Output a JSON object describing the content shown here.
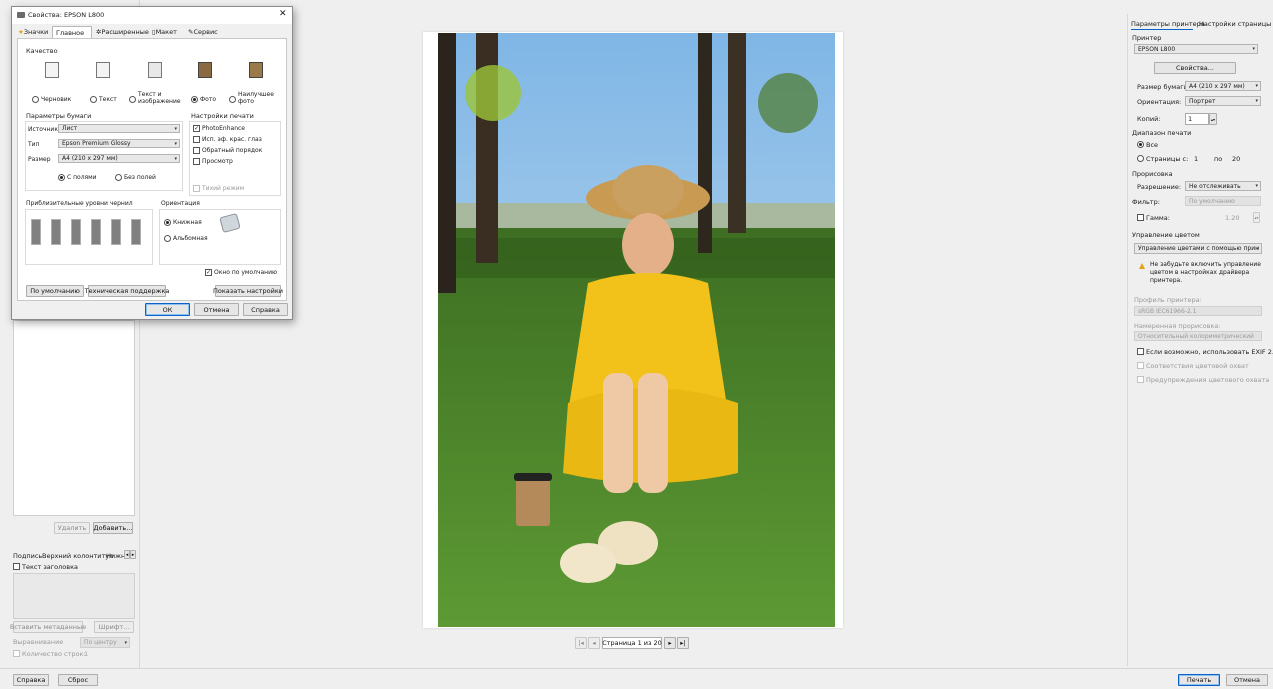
{
  "dialog": {
    "title": "Свойства: EPSON L800",
    "tabs": [
      "Значки",
      "Главное",
      "Расширенные",
      "Макет",
      "Сервис"
    ],
    "quality_label": "Качество",
    "quality_options": [
      "Черновик",
      "Текст",
      "Текст и изображение",
      "Фото",
      "Наилучшее фото"
    ],
    "paper_params_label": "Параметры бумаги",
    "source_label": "Источник",
    "source_value": "Лист",
    "type_label": "Тип",
    "type_value": "Epson Premium Glossy",
    "size_label": "Размер",
    "size_value": "A4 (210 x 297 мм)",
    "border_on": "С полями",
    "border_off": "Без полей",
    "print_settings_label": "Настройки печати",
    "print_settings": [
      "PhotoEnhance",
      "Исп. эф. крас. глаз",
      "Обратный порядок",
      "Просмотр"
    ],
    "quiet_mode": "Тихий режим",
    "ink_levels_label": "Приблизительные уровни чернил",
    "orientation_label": "Ориентация",
    "orientation_portrait": "Книжная",
    "orientation_landscape": "Альбомная",
    "always_show": "Окно по умолчанию",
    "btn_defaults": "По умолчанию",
    "btn_support": "Техническая поддержка",
    "btn_show_settings": "Показать настройки",
    "btn_ok": "ОК",
    "btn_cancel": "Отмена",
    "btn_help": "Справка"
  },
  "left_panel": {
    "btn_delete": "Удалить",
    "btn_add": "Добавить...",
    "tabs": [
      "Подпись",
      "Верхний колонтитул",
      "Нижн"
    ],
    "header_text_label": "Текст заголовка",
    "btn_insert_meta": "Вставить метаданные",
    "btn_font": "Шрифт...",
    "align_label": "Выравнивание",
    "align_value": "По центру",
    "lines_label": "Количество строк:",
    "lines_value": "1"
  },
  "preview": {
    "page_indicator": "Страница 1 из 20"
  },
  "right_panel": {
    "tabs": [
      "Параметры принтера",
      "Настройки страницы"
    ],
    "printer_label": "Принтер",
    "printer_value": "EPSON L800",
    "btn_properties": "Свойства...",
    "paper_size_label": "Размер бумаги:",
    "paper_size_value": "A4 (210 x 297 мм)",
    "orientation_label": "Ориентация:",
    "orientation_value": "Портрет",
    "copies_label": "Копий:",
    "copies_value": "1",
    "range_label": "Диапазон печати",
    "range_all": "Все",
    "range_pages": "Страницы с:",
    "range_from": "1",
    "range_to_label": "по",
    "range_to": "20",
    "rasterize_label": "Прорисовка",
    "resolution_label": "Разрешение:",
    "resolution_value": "Не отслеживать",
    "filter_label": "Фильтр:",
    "filter_value": "По умолчанию",
    "gamma_label": "Гамма:",
    "gamma_value": "1.20",
    "color_mgmt_label": "Управление цветом",
    "color_mgmt_value": "Управление цветами с помощью прин",
    "warning_text": "Не забудьте включить управление цветом в настройках драйвера принтера.",
    "profile_label": "Профиль принтера:",
    "profile_value": "sRGB IEC61966-2.1",
    "intent_label": "Намеренная прорисовка:",
    "intent_value": "Относительный колориметрический",
    "exif_label": "Если возможно, использовать EXIF 2.2",
    "gamut_label": "Соответствия цветовой охват",
    "gamut_warn_label": "Предупреждения цветового охвата"
  },
  "bottom_bar": {
    "btn_help": "Справка",
    "btn_reset": "Сброс",
    "btn_print": "Печать",
    "btn_cancel": "Отмена"
  },
  "colors": {
    "accent": "#0a64c8",
    "window_bg": "#efefef",
    "dress": "#f2c21a",
    "sky": "#8ec3ea",
    "grass": "#4f8a2a"
  }
}
